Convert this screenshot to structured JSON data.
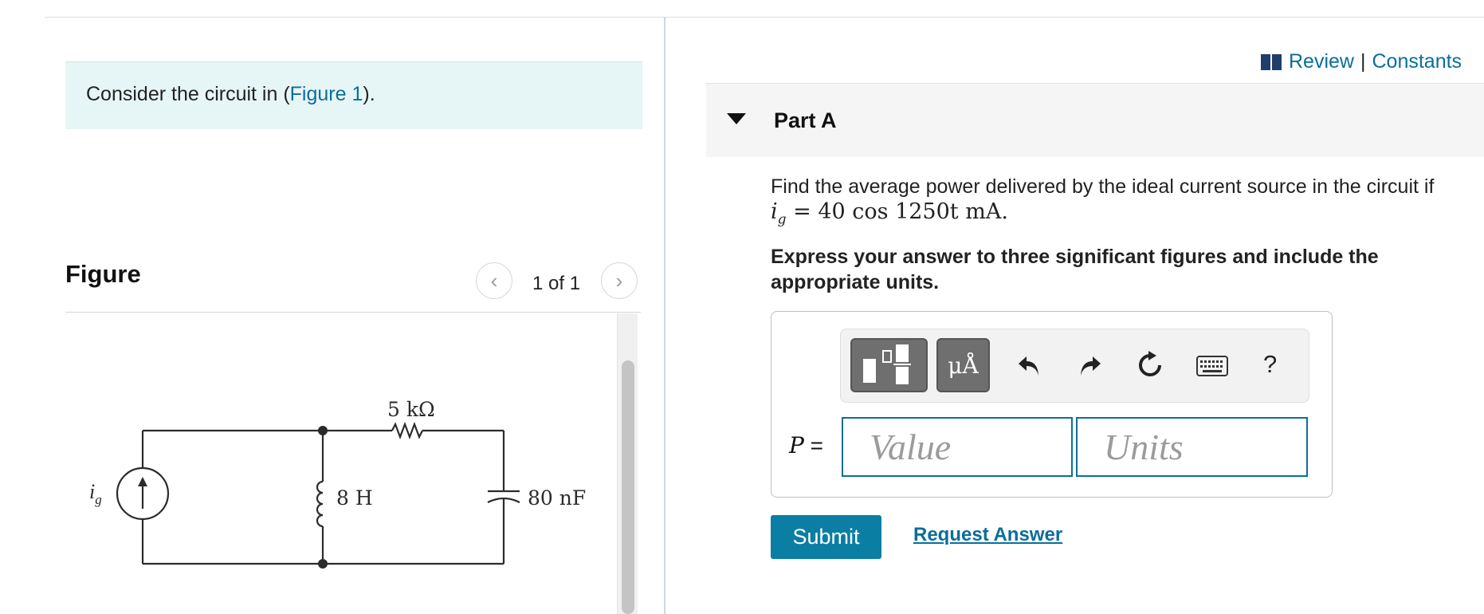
{
  "intro": {
    "prefix": "Consider the circuit in (",
    "link": "Figure 1",
    "suffix": ")."
  },
  "figure_panel": {
    "heading": "Figure",
    "page_count": "1 of 1",
    "prev_icon": "chevron-left-icon",
    "next_icon": "chevron-right-icon",
    "circuit": {
      "source_label_main": "i",
      "source_label_sub": "g",
      "resistor": "5 kΩ",
      "inductor": "8 H",
      "capacitor": "80 nF"
    }
  },
  "header_links": {
    "review": "Review",
    "separator": "|",
    "constants": "Constants",
    "icon": "book-icon"
  },
  "part": {
    "label": "Part A",
    "question": "Find the average power delivered by the ideal current source in the circuit if",
    "equation_lhs_main": "i",
    "equation_lhs_sub": "g",
    "equation_rhs": " = 40 cos 1250t mA.",
    "instruction": "Express your answer to three significant figures and include the appropriate units."
  },
  "toolbar": {
    "units_label": "μÅ",
    "help_label": "?",
    "icons": [
      "templates-icon",
      "units-icon",
      "undo-icon",
      "redo-icon",
      "reset-icon",
      "keyboard-icon",
      "help-icon"
    ]
  },
  "answer": {
    "variable": "P",
    "equals": " =",
    "value_placeholder": "Value",
    "units_placeholder": "Units"
  },
  "actions": {
    "submit": "Submit",
    "request_answer": "Request Answer"
  },
  "colors": {
    "accent": "#0b6e99",
    "submit_bg": "#0b7ea3",
    "intro_bg": "#e6f5f6"
  }
}
